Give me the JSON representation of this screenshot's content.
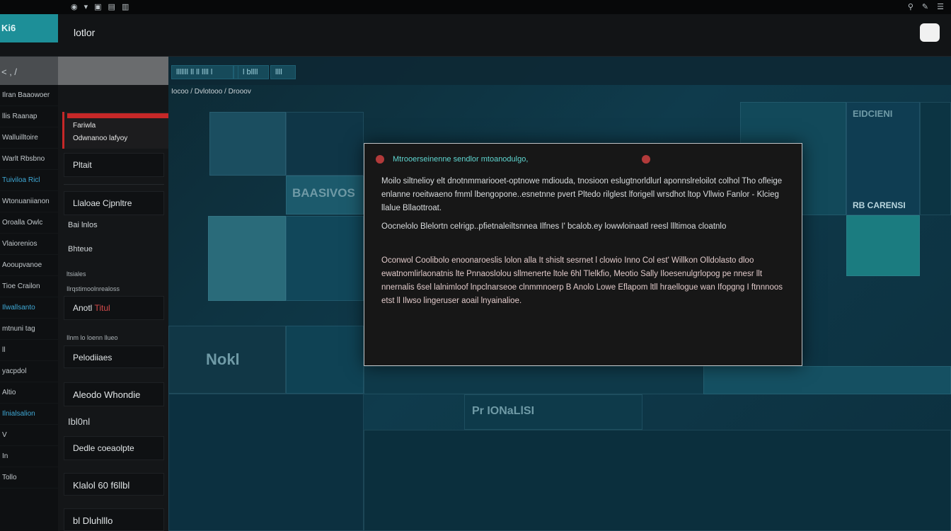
{
  "system_bar": {
    "left_items": [
      "◉",
      "▾",
      "▣",
      "▤",
      "▥"
    ],
    "right_items": [
      "⚲",
      "✎",
      "☰"
    ]
  },
  "header": {
    "logo": "Ki6",
    "title": "lotlor",
    "action_icon": "tag-icon"
  },
  "left_nav": {
    "top": "< , /",
    "items": [
      {
        "label": "Ilran Baaowoer",
        "accent": false
      },
      {
        "label": "llis Raanap",
        "accent": false
      },
      {
        "label": "Walluilltoire",
        "accent": false
      },
      {
        "label": "Warlt Rbsbno",
        "accent": false
      },
      {
        "label": "Tuiviloa Ricl",
        "accent": true
      },
      {
        "label": "Wtonuaniianon",
        "accent": false
      },
      {
        "label": "Oroalla Owlc",
        "accent": false
      },
      {
        "label": "Vlaiorenios",
        "accent": false
      },
      {
        "label": "Aooupvanoe",
        "accent": false
      },
      {
        "label": "Tioe Crailon",
        "accent": false
      },
      {
        "label": "Ilwallsanto",
        "accent": true
      },
      {
        "label": "mtnuni tag",
        "accent": false
      },
      {
        "label": "ll",
        "accent": false
      },
      {
        "label": "yacpdol",
        "accent": false
      },
      {
        "label": "Altio",
        "accent": false
      },
      {
        "label": "Ilnialsalion",
        "accent": true
      },
      {
        "label": "V",
        "accent": false
      },
      {
        "label": "In",
        "accent": false
      },
      {
        "label": "Tollo",
        "accent": false
      }
    ]
  },
  "panel2": {
    "red_block_line1": "Fariwla",
    "red_block_line2": "Odwnanoo lafyoy",
    "box1": "Pltait",
    "box2": "Llaloae Cjpnltre",
    "plain1": "Bai lnlos",
    "plain2": "Bhteue",
    "small1": "ltsiales",
    "small2": "Ilrqstimoolnrealoss",
    "box3_left": "Anotl",
    "box3_right": "Titul",
    "small3": "Ilnm lo loenn llueo",
    "box4": "Pelodiiaes",
    "box5": "Aleodo Whondie",
    "plain3": "Ibl0nl",
    "plain4": "Dedle coeaolpte",
    "box6": "Klalol 60 f6llbl",
    "box7": "bl Dluhlllo"
  },
  "main": {
    "tabs": [
      "lllllll ll ll llll l",
      "l",
      "l bllll",
      "llll"
    ],
    "breadcrumb": "Iocoo  /  Dvlotooo  /  Drooov",
    "tile_labels": [
      "Nokl",
      "BAASIVOS",
      "EIDCIENI",
      "RB CARENSI",
      "Pr IONaLlSI"
    ]
  },
  "dialog": {
    "title": "Mtrooerseinenne sendlor mtoanodulgo,",
    "para1": "Moilo siltnelioy elt dnotnmmariooet-optnowe mdiouda, tnosioon eslugtnorldlurl aponnslreloilot colhol Tho ofleige enlanne roeitwaeno fmml lbengopone..esnetnne pvert Pltedo rilglest lforigell wrsdhot ltop Vllwio Fanlor - Klcieg llalue Bllaottroat.",
    "para2": "Oocnelolo Blelortn celrigp..pfietnaleiltsnnea Ilfnes I' bcalob.ey lowwloinaatl reesl llltimoa cloatnlo",
    "para3": "Oconwol Coolibolo enoonaroeslis lolon alla It shislt sesrnet l clowio Inno Col est' Willkon Olldolasto dloo ewatnomlirlaonatnis lte Pnnaoslolou sllmenerte ltole 6hl Tlelkfio, Meotio Sally Iloesenulgrlopog pe nnesr llt nnernalis 6sel lalnimloof lnpclnarseoe clnmmnoerp B Anolo Lowe Eflapom ltll hraellogue wan Ifopgng I ftnnnoos etst ll Ilwso lingeruser aoail lnyainalioe."
  }
}
